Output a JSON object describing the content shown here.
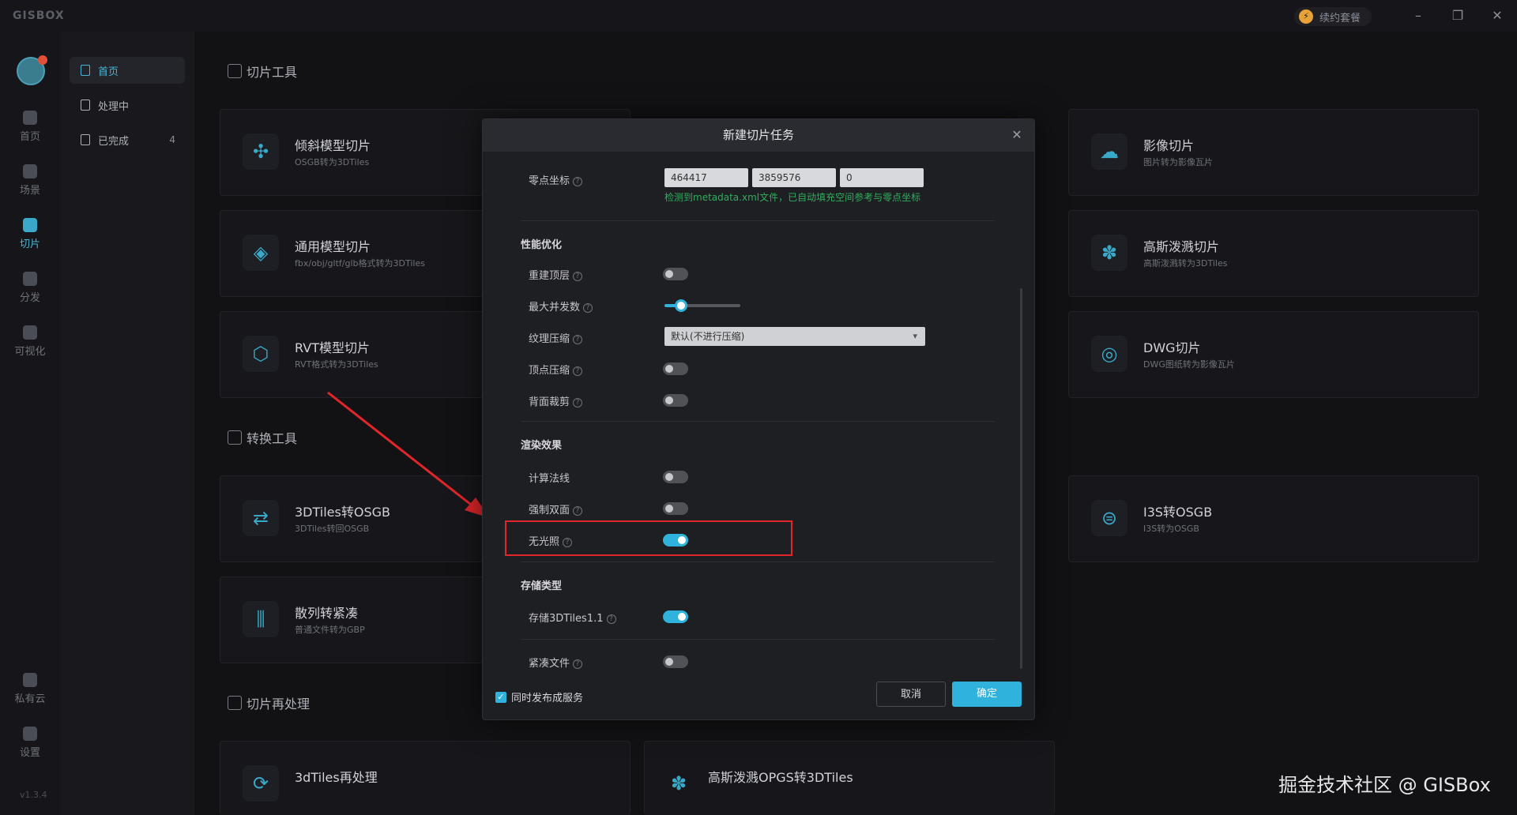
{
  "app": {
    "brand": "GISBOX",
    "renew_label": "续约套餐",
    "version": "v1.3.4"
  },
  "window_controls": {
    "minimize": "–",
    "restore": "❐",
    "close": "✕"
  },
  "rail": {
    "items": [
      {
        "label": "首页"
      },
      {
        "label": "场景"
      },
      {
        "label": "切片"
      },
      {
        "label": "分发"
      },
      {
        "label": "可视化"
      },
      {
        "label": "私有云"
      },
      {
        "label": "设置"
      }
    ]
  },
  "subnav": {
    "items": [
      {
        "label": "首页"
      },
      {
        "label": "处理中"
      },
      {
        "label": "已完成",
        "count": "4"
      }
    ]
  },
  "sections": {
    "slice_tools": "切片工具",
    "convert_tools": "转换工具",
    "reprocess": "切片再处理"
  },
  "cards": [
    {
      "title": "倾斜模型切片",
      "subtitle": "OSGB转为3DTiles"
    },
    {
      "title": "通用模型切片",
      "subtitle": "fbx/obj/gltf/glb格式转为3DTiles"
    },
    {
      "title": "RVT模型切片",
      "subtitle": "RVT格式转为3DTiles"
    },
    {
      "title": "影像切片",
      "subtitle": "图片转为影像瓦片"
    },
    {
      "title": "高斯泼溅切片",
      "subtitle": "高斯泼溅转为3DTiles"
    },
    {
      "title": "DWG切片",
      "subtitle": "DWG图纸转为影像瓦片"
    },
    {
      "title": "3DTiles转OSGB",
      "subtitle": "3DTiles转回OSGB"
    },
    {
      "title": "散列转紧凑",
      "subtitle": "普通文件转为GBP"
    },
    {
      "title": "I3S转OSGB",
      "subtitle": "I3S转为OSGB"
    },
    {
      "title": "3dTiles再处理",
      "subtitle": ""
    },
    {
      "title": "高斯泼溅OPGS转3DTiles",
      "subtitle": ""
    }
  ],
  "modal": {
    "title": "新建切片任务",
    "origin": {
      "label": "零点坐标",
      "x": "464417",
      "y": "3859576",
      "z": "0",
      "hint": "检测到metadata.xml文件，已自动填充空间参考与零点坐标"
    },
    "perf": {
      "heading": "性能优化",
      "rebuild_top": {
        "label": "重建顶层",
        "on": false
      },
      "max_concurrency": {
        "label": "最大并发数",
        "fraction": 0.22
      },
      "texture_compress": {
        "label": "纹理压缩",
        "value": "默认(不进行压缩)"
      },
      "vertex_compress": {
        "label": "顶点压缩",
        "on": false
      },
      "backface_cull": {
        "label": "背面裁剪",
        "on": false
      }
    },
    "render": {
      "heading": "渲染效果",
      "compute_normals": {
        "label": "计算法线",
        "on": false
      },
      "force_double_sided": {
        "label": "强制双面",
        "on": false
      },
      "unlit": {
        "label": "无光照",
        "on": true
      }
    },
    "storage": {
      "heading": "存储类型",
      "tiles11": {
        "label": "存储3DTiles1.1",
        "on": true
      },
      "compact": {
        "label": "紧凑文件",
        "on": false
      }
    },
    "publish_service": {
      "label": "同时发布成服务",
      "checked": true
    },
    "cancel_label": "取消",
    "ok_label": "确定"
  },
  "watermark": "掘金技术社区 @ GISBox",
  "colors": {
    "accent": "#2fb2dc",
    "highlight": "#e0262a",
    "hint": "#2fae5b"
  }
}
